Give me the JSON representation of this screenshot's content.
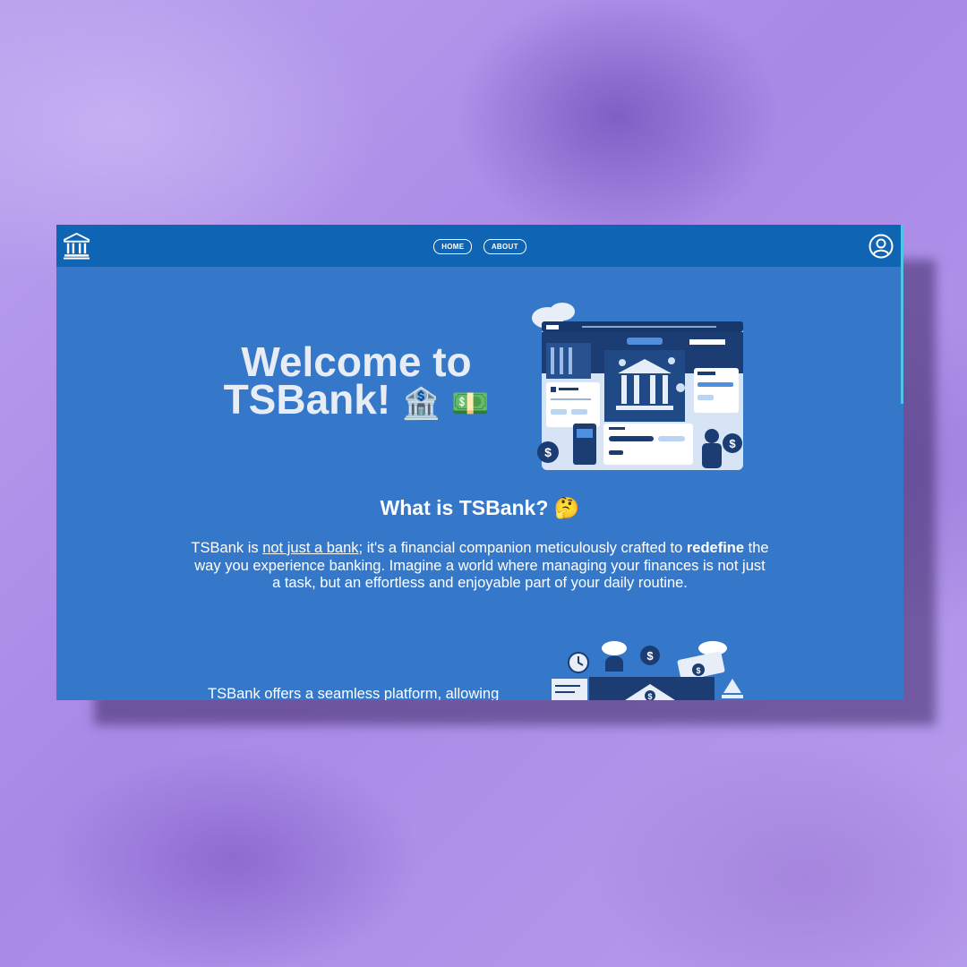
{
  "nav": {
    "home_label": "HOME",
    "about_label": "ABOUT",
    "logo_icon": "bank-icon",
    "user_icon": "user-account-icon"
  },
  "hero": {
    "title_line1": "Welcome to",
    "title_line2": "TSBank!",
    "emoji1": "🏦",
    "emoji2": "💵"
  },
  "about": {
    "heading": "What is TSBank?",
    "heading_emoji": "🤔",
    "p1_before": "TSBank is ",
    "p1_underline": "not just a bank",
    "p1_after": "; it's a financial companion meticulously crafted to ",
    "p1_bold": "redefine",
    "p1_end": " the way you experience banking. Imagine a world where managing your finances is not just a task, but an effortless and enjoyable part of your daily routine.",
    "p2": "TSBank offers a seamless platform, allowing"
  },
  "colors": {
    "navbar": "#0f64b3",
    "content": "#3578c9",
    "scrollbar": "#4fc3e8"
  }
}
